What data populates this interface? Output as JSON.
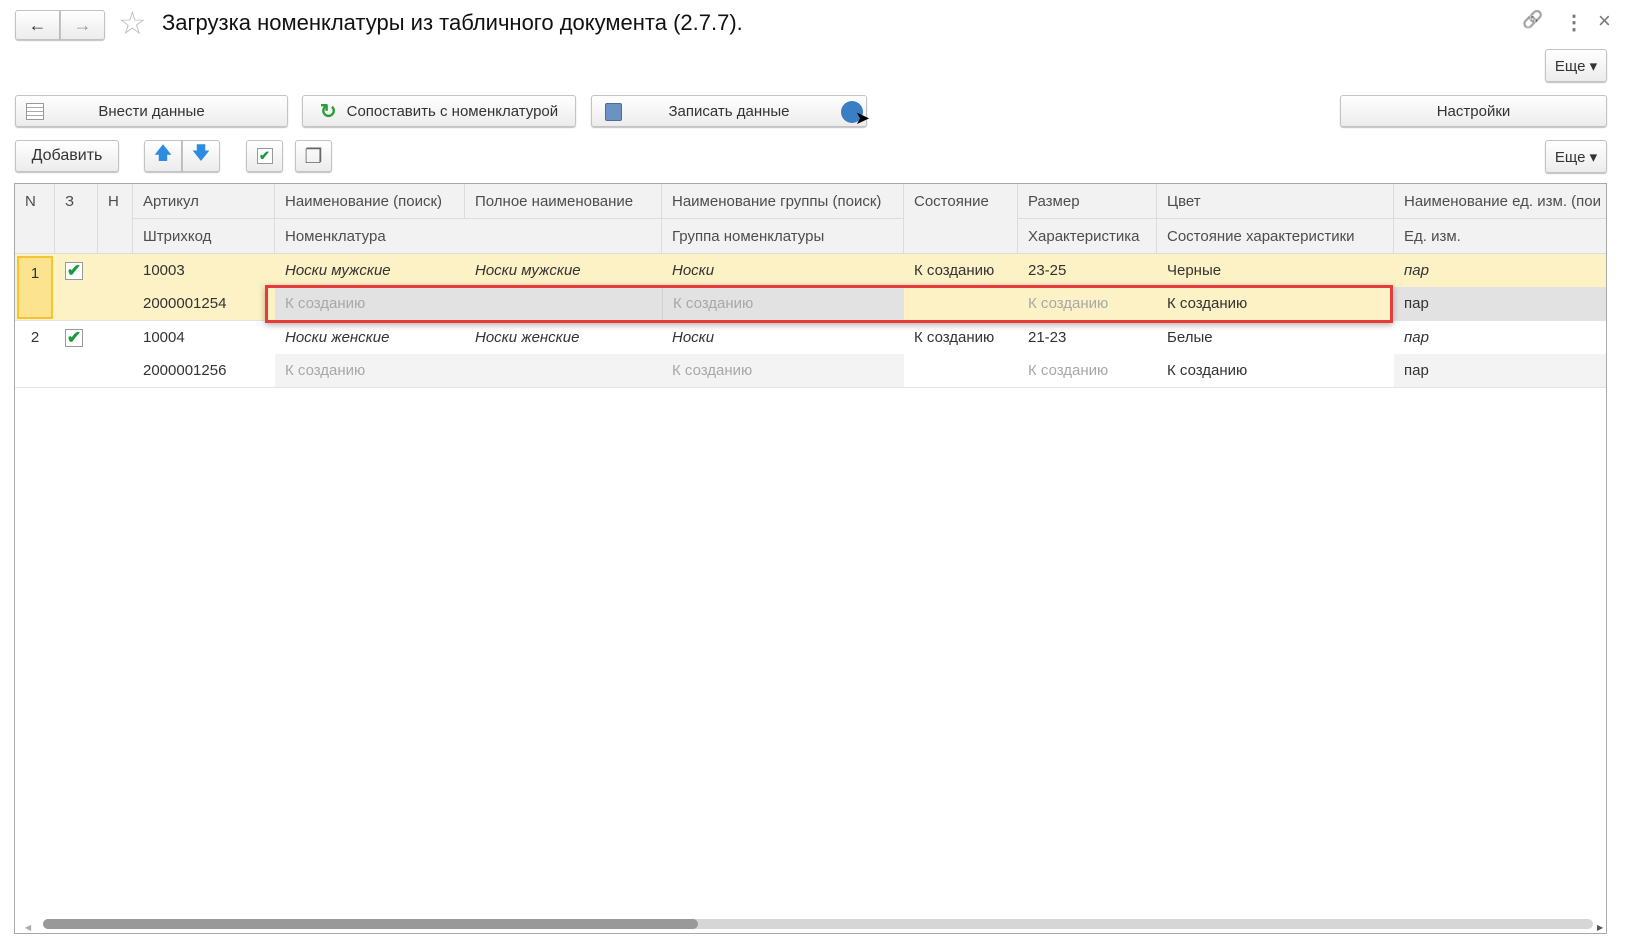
{
  "header": {
    "title": "Загрузка номенклатуры из табличного документа (2.7.7).",
    "back": "←",
    "forward": "→",
    "star": "☆",
    "link": "🔗",
    "more": "⋮",
    "close": "×"
  },
  "toolbar1": {
    "more": "Еще ▾",
    "enter_data": "Внести данные",
    "match": "Сопоставить с номенклатурой",
    "save": "Записать данные",
    "settings": "Настройки"
  },
  "toolbar2": {
    "add": "Добавить",
    "up": "🡅",
    "down": "🡇",
    "check": "✔",
    "copy": "❐",
    "more": "Еще ▾"
  },
  "columns": {
    "n": "N",
    "z": "З",
    "h": "Н",
    "article": "Артикул",
    "barcode": "Штрихкод",
    "name_search": "Наименование (поиск)",
    "full_name": "Полное наименование",
    "nomenclature": "Номенклатура",
    "group_search": "Наименование группы (поиск)",
    "group": "Группа номенклатуры",
    "state": "Состояние",
    "size": "Размер",
    "characteristic": "Характеристика",
    "color": "Цвет",
    "char_state": "Состояние характеристики",
    "unit_search": "Наименование ед. изм. (пои",
    "unit": "Ед. изм."
  },
  "rows": [
    {
      "n": "1",
      "checked": "✔",
      "article": "10003",
      "barcode": "2000001254",
      "name": "Носки мужские",
      "full_name": "Носки мужские",
      "nomenclature": "К созданию",
      "group_name": "Носки",
      "group": "К созданию",
      "state": "К созданию",
      "size": "23-25",
      "characteristic": "К созданию",
      "color": "Черные",
      "char_state": "К созданию",
      "unit_name": "пар",
      "unit": "пар"
    },
    {
      "n": "2",
      "checked": "✔",
      "article": "10004",
      "barcode": "2000001256",
      "name": "Носки женские",
      "full_name": "Носки женские",
      "nomenclature": "К созданию",
      "group_name": "Носки",
      "group": "К созданию",
      "state": "К созданию",
      "size": "21-23",
      "characteristic": "К созданию",
      "color": "Белые",
      "char_state": "К созданию",
      "unit_name": "пар",
      "unit": "пар"
    }
  ],
  "colors": {
    "selected_row": "#fdf1c6",
    "highlight": "#e83a3a",
    "accent": "#3a7fc4"
  }
}
